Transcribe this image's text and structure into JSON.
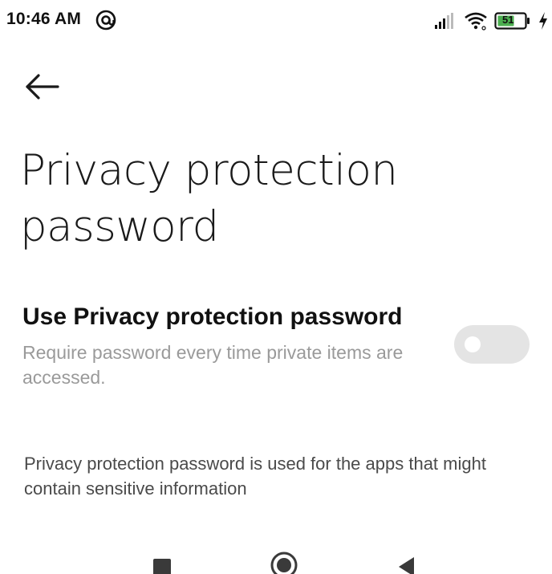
{
  "status_bar": {
    "time": "10:46 AM",
    "battery_level": "51",
    "icons": [
      "at-sign-icon",
      "signal-icon",
      "wifi-icon",
      "battery-icon",
      "charging-bolt-icon"
    ]
  },
  "header": {
    "back_icon": "arrow-left-icon",
    "title": "Privacy protection password"
  },
  "setting": {
    "title": "Use Privacy protection password",
    "description": "Require password every time private items are accessed.",
    "toggle_state": false
  },
  "info": {
    "text": "Privacy protection password is used for the apps that might contain sensitive information"
  },
  "nav_bar": {
    "icons": [
      "recents-square-icon",
      "home-circle-icon",
      "back-triangle-icon"
    ]
  },
  "colors": {
    "background": "#ffffff",
    "title_text": "#1a1a1a",
    "secondary_text": "#9a9a9a",
    "toggle_off": "#e4e4e4",
    "battery_fill": "#4caf50"
  }
}
